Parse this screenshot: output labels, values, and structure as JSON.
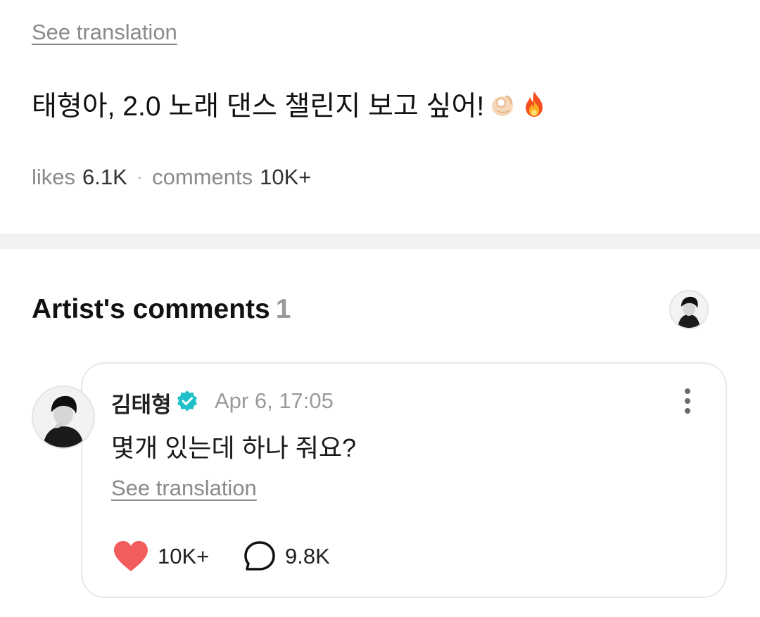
{
  "post": {
    "translate_label": "See translation",
    "text": "태형아, 2.0 노래 댄스 챌린지 보고 싶어!",
    "emojis": [
      "ok-hand-emoji",
      "fire-emoji"
    ],
    "likes_label": "likes",
    "likes_value": "6.1K",
    "separator": "·",
    "comments_label": "comments",
    "comments_value": "10K+"
  },
  "artist_section": {
    "title": "Artist's comments",
    "count": "1"
  },
  "comment": {
    "author": "김태형",
    "verified": true,
    "timestamp": "Apr 6, 17:05",
    "text": "몇개 있는데 하나 줘요?",
    "translate_label": "See translation",
    "likes": "10K+",
    "replies": "9.8K"
  },
  "colors": {
    "heart": "#f25c5c",
    "verified_badge": "#1fc1c9",
    "muted_text": "#8a8a8a",
    "divider": "#f2f2f2"
  }
}
